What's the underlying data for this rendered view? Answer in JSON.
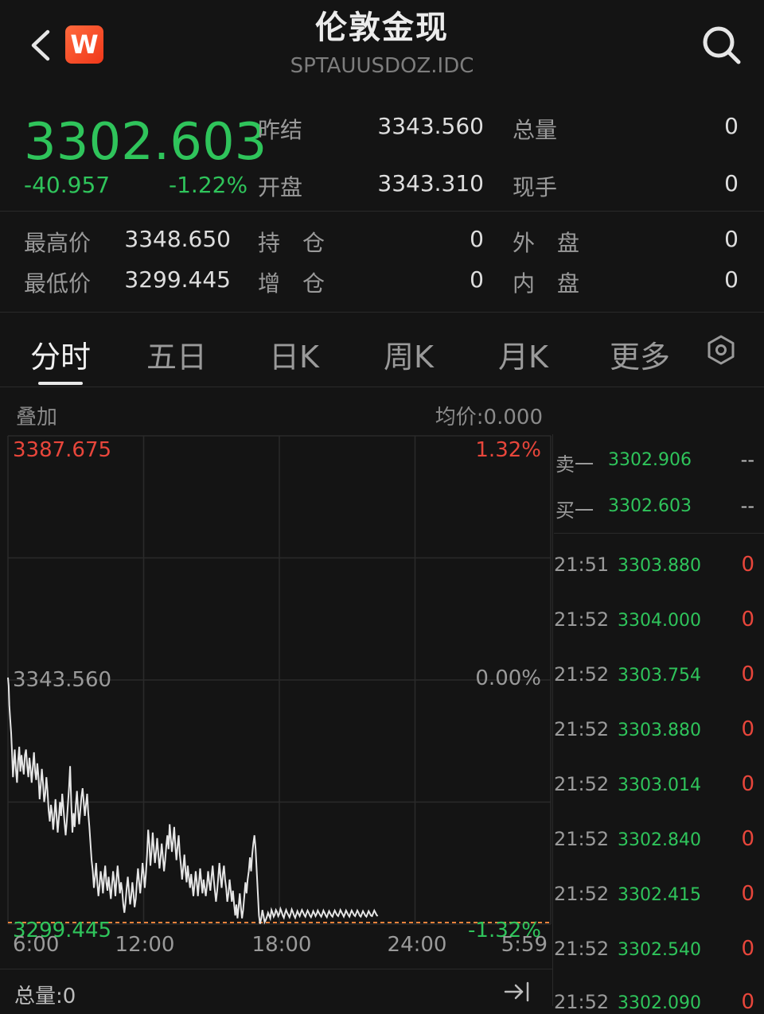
{
  "header": {
    "title": "伦敦金现",
    "code": "SPTAUUSDOZ.IDC",
    "logo_letter": "W"
  },
  "quote": {
    "price": "3302.603",
    "change": "-40.957",
    "change_pct": "-1.22%",
    "fields": [
      {
        "label": "昨结",
        "value": "3343.560"
      },
      {
        "label": "开盘",
        "value": "3343.310"
      },
      {
        "label": "总量",
        "value": "0"
      },
      {
        "label": "现手",
        "value": "0"
      },
      {
        "label": "最高价",
        "value": "3348.650"
      },
      {
        "label": "最低价",
        "value": "3299.445"
      },
      {
        "label": "持　仓",
        "value": "0"
      },
      {
        "label": "增　仓",
        "value": "0"
      },
      {
        "label": "外　盘",
        "value": "0"
      },
      {
        "label": "内　盘",
        "value": "0"
      }
    ]
  },
  "tabs": [
    "分时",
    "五日",
    "日K",
    "周K",
    "月K",
    "更多"
  ],
  "chart_header": {
    "overlay_label": "叠加",
    "avg_label": "均价:0.000"
  },
  "chart_data": {
    "type": "line",
    "x_ticks": [
      "6:00",
      "12:00",
      "18:00",
      "24:00",
      "5:59"
    ],
    "y_left_ticks": [
      "3387.675",
      "3343.560",
      "3299.445"
    ],
    "y_right_ticks": [
      "1.32%",
      "0.00%",
      "-1.32%"
    ],
    "ylim": [
      3299.445,
      3387.675
    ],
    "reference": 3343.56,
    "colors": {
      "up": "#e8463b",
      "flat": "#9a9a9a",
      "down": "#2fc45b",
      "line": "#e6e6e6",
      "ref": "#e8823b"
    },
    "x": [
      0,
      0.03,
      0.06,
      0.1,
      0.14,
      0.18,
      0.22,
      0.26,
      0.3,
      0.35,
      0.4,
      0.45,
      0.5,
      0.55,
      0.6,
      0.65,
      0.7,
      0.75,
      0.8,
      0.85,
      0.9,
      0.95,
      1.0,
      1.05,
      1.1,
      1.15,
      1.2,
      1.25,
      1.3,
      1.35,
      1.4,
      1.45,
      1.5,
      1.55,
      1.6,
      1.65,
      1.7,
      1.75,
      1.8,
      1.85,
      1.9,
      1.95,
      2.0,
      2.05,
      2.1,
      2.15,
      2.2,
      2.25,
      2.3,
      2.35,
      2.4,
      2.45,
      2.5,
      2.55,
      2.6,
      2.65,
      2.7,
      2.75,
      2.8,
      2.85,
      2.9,
      2.95,
      3.0,
      3.05,
      3.1,
      3.15,
      3.2,
      3.25,
      3.3,
      3.35,
      3.4,
      3.45,
      3.5,
      3.55,
      3.6,
      3.65,
      3.7,
      3.75,
      3.8,
      3.85,
      3.9,
      3.95,
      4.0,
      4.05,
      4.1,
      4.15,
      4.2,
      4.25,
      4.3,
      4.35,
      4.4,
      4.45,
      4.5,
      4.55,
      4.6,
      4.65,
      4.7,
      4.75,
      4.8,
      4.85,
      4.9,
      4.95,
      5.0,
      5.05,
      5.1,
      5.15,
      5.2,
      5.25,
      5.3,
      5.35,
      5.4,
      5.45,
      5.5,
      5.55,
      5.6,
      5.65,
      5.7,
      5.75,
      5.8,
      5.85,
      5.9,
      5.95,
      6.0,
      6.05,
      6.1,
      6.15,
      6.2,
      6.25,
      6.3,
      6.35,
      6.4,
      6.45,
      6.5,
      6.55,
      6.6,
      6.65,
      6.7,
      6.75,
      6.8,
      6.85,
      6.9,
      6.95,
      7.0,
      7.05,
      7.1,
      7.15,
      7.2,
      7.25,
      7.3,
      7.35,
      7.4,
      7.45,
      7.5,
      7.55,
      7.6,
      7.65,
      7.7,
      7.75,
      7.8,
      7.85,
      7.9,
      7.95,
      8.0,
      8.05,
      8.1,
      8.15,
      8.2,
      8.25,
      8.3,
      8.35,
      8.4,
      8.45,
      8.5,
      8.55,
      8.6,
      8.65,
      8.7,
      8.75,
      8.8,
      8.85,
      8.9,
      8.95,
      9.0,
      9.05,
      9.1,
      9.15,
      9.2,
      9.25,
      9.3,
      9.35,
      9.4,
      9.45,
      9.5,
      9.55,
      9.6,
      9.65,
      9.7,
      9.75,
      9.8,
      9.85,
      9.9,
      9.95,
      10.0,
      10.05,
      10.1,
      10.15,
      10.2,
      10.25,
      10.3,
      10.35,
      10.4,
      10.45,
      10.5,
      10.55,
      10.6,
      10.65,
      10.7,
      10.75,
      10.8,
      10.85,
      10.9,
      10.95,
      11.0,
      11.05,
      11.1,
      11.15,
      11.2,
      11.25,
      11.3,
      11.35,
      11.4,
      11.45,
      11.5,
      11.55,
      11.6,
      11.65,
      11.7,
      11.75,
      11.8,
      11.85,
      11.9,
      11.95,
      12.0,
      12.05,
      12.1,
      12.15,
      12.2,
      12.25,
      12.3,
      12.35,
      12.4,
      12.45,
      12.5,
      12.55,
      12.6,
      12.65,
      12.7,
      12.75,
      12.8,
      12.85,
      12.9,
      12.95,
      13.0,
      13.05,
      13.1,
      13.15,
      13.2,
      13.25,
      13.3,
      13.35,
      13.4,
      13.45,
      13.5,
      13.55,
      13.6,
      13.65,
      13.7,
      13.75,
      13.8,
      13.85,
      13.9,
      13.95,
      14.0,
      14.05,
      14.1,
      14.15,
      14.2,
      14.25,
      14.3,
      14.35,
      14.4,
      14.45,
      14.5,
      14.55,
      14.6,
      14.65,
      14.7,
      14.75,
      14.8,
      14.85,
      14.9,
      14.95,
      15.0,
      15.05,
      15.1,
      15.15,
      15.2,
      15.25,
      15.3,
      15.35,
      15.4,
      15.45,
      15.5,
      15.55,
      15.6,
      15.65,
      15.7,
      15.75,
      15.8,
      15.85,
      15.9,
      15.95,
      16.0,
      16.05,
      16.1,
      16.15,
      16.2,
      16.25,
      16.3,
      16.35,
      16.4,
      16.45,
      16.5
    ],
    "values": [
      3344.0,
      3342.5,
      3339.0,
      3336.5,
      3334.0,
      3330.5,
      3326.0,
      3328.5,
      3331.0,
      3327.5,
      3325.0,
      3329.0,
      3331.5,
      3327.0,
      3330.0,
      3328.0,
      3326.5,
      3330.0,
      3331.0,
      3328.0,
      3326.0,
      3329.5,
      3327.5,
      3325.0,
      3328.0,
      3330.5,
      3327.0,
      3325.5,
      3328.5,
      3326.0,
      3322.0,
      3324.5,
      3327.5,
      3325.0,
      3321.5,
      3323.0,
      3326.0,
      3323.5,
      3320.0,
      3318.0,
      3321.0,
      3319.5,
      3316.5,
      3319.0,
      3322.0,
      3319.0,
      3316.0,
      3318.5,
      3321.5,
      3319.0,
      3323.0,
      3320.5,
      3318.0,
      3315.5,
      3318.0,
      3321.0,
      3324.0,
      3328.0,
      3321.0,
      3316.0,
      3319.5,
      3317.0,
      3321.0,
      3323.5,
      3320.0,
      3317.5,
      3320.0,
      3322.5,
      3324.0,
      3321.5,
      3319.0,
      3321.0,
      3323.0,
      3319.5,
      3317.0,
      3314.0,
      3311.0,
      3309.0,
      3306.0,
      3308.0,
      3310.5,
      3307.0,
      3304.5,
      3306.5,
      3309.0,
      3307.5,
      3305.0,
      3308.0,
      3310.0,
      3307.0,
      3305.5,
      3308.0,
      3306.0,
      3304.0,
      3306.5,
      3309.0,
      3307.0,
      3304.5,
      3307.5,
      3310.0,
      3307.5,
      3305.0,
      3307.0,
      3305.5,
      3303.0,
      3301.5,
      3303.5,
      3306.0,
      3308.0,
      3305.5,
      3303.0,
      3304.5,
      3307.0,
      3305.0,
      3302.5,
      3304.0,
      3307.0,
      3309.5,
      3307.0,
      3305.0,
      3307.5,
      3310.5,
      3308.5,
      3306.0,
      3308.5,
      3312.0,
      3316.5,
      3314.0,
      3310.0,
      3312.5,
      3316.0,
      3313.0,
      3310.5,
      3312.5,
      3315.0,
      3312.0,
      3309.5,
      3311.5,
      3314.0,
      3311.5,
      3309.0,
      3311.0,
      3313.5,
      3315.5,
      3313.0,
      3317.5,
      3315.0,
      3312.5,
      3314.5,
      3317.0,
      3313.5,
      3311.0,
      3313.5,
      3315.5,
      3312.0,
      3310.0,
      3307.5,
      3309.5,
      3312.0,
      3309.0,
      3307.0,
      3310.0,
      3308.0,
      3306.0,
      3308.5,
      3306.5,
      3304.5,
      3306.5,
      3309.0,
      3307.0,
      3304.5,
      3307.0,
      3309.5,
      3307.0,
      3305.0,
      3307.5,
      3306.0,
      3304.5,
      3306.5,
      3309.0,
      3307.0,
      3305.5,
      3308.0,
      3310.0,
      3307.5,
      3305.5,
      3303.5,
      3305.5,
      3308.0,
      3310.5,
      3308.0,
      3306.0,
      3308.5,
      3310.0,
      3307.5,
      3306.0,
      3303.5,
      3305.0,
      3307.5,
      3305.5,
      3303.5,
      3305.5,
      3303.0,
      3301.0,
      3303.0,
      3300.5,
      3302.5,
      3305.0,
      3302.5,
      3300.5,
      3302.0,
      3304.5,
      3307.0,
      3305.0,
      3307.5,
      3309.0,
      3311.5,
      3309.0,
      3312.0,
      3314.0,
      3315.5,
      3313.0,
      3309.0,
      3305.0,
      3301.0,
      3299.5,
      3300.5,
      3302.0,
      3301.0,
      3299.8,
      3300.2,
      3300.8,
      3301.5,
      3301.0,
      3300.5,
      3302.0,
      3301.5,
      3300.8,
      3301.2,
      3302.0,
      3301.6,
      3300.9,
      3301.3,
      3302.2,
      3301.7,
      3301.0,
      3300.6,
      3301.4,
      3302.0,
      3301.5,
      3301.1,
      3300.7,
      3301.3,
      3302.1,
      3301.6,
      3301.0,
      3300.6,
      3301.2,
      3301.8,
      3301.3,
      3300.9,
      3301.5,
      3302.0,
      3301.6,
      3301.1,
      3300.8,
      3301.4,
      3301.9,
      3301.5,
      3301.0,
      3300.7,
      3301.2,
      3301.8,
      3301.4,
      3300.9,
      3301.3,
      3301.9,
      3301.5,
      3301.1,
      3300.8,
      3301.3,
      3301.9,
      3301.5,
      3301.0,
      3300.7,
      3301.3,
      3301.8,
      3301.4,
      3301.0,
      3300.8,
      3301.4,
      3301.9,
      3301.5,
      3301.1,
      3300.9,
      3301.4,
      3302.0,
      3301.6,
      3301.2,
      3300.8,
      3301.3,
      3301.9,
      3301.5,
      3301.1,
      3300.8,
      3301.4,
      3301.9,
      3301.5,
      3301.1,
      3300.9,
      3301.4,
      3301.9,
      3301.5,
      3301.0,
      3300.8,
      3301.3,
      3301.8,
      3301.4,
      3301.0,
      3300.8,
      3301.3,
      3301.8,
      3301.4,
      3301.0,
      3300.9,
      3301.4,
      3301.9,
      3301.5,
      3301.1,
      3300.9
    ]
  },
  "order_book": [
    {
      "label": "卖一",
      "price": "3302.906",
      "qty": "--"
    },
    {
      "label": "买一",
      "price": "3302.603",
      "qty": "--"
    }
  ],
  "ticks": [
    {
      "time": "21:51",
      "price": "3303.880",
      "vol": "0"
    },
    {
      "time": "21:52",
      "price": "3304.000",
      "vol": "0"
    },
    {
      "time": "21:52",
      "price": "3303.754",
      "vol": "0"
    },
    {
      "time": "21:52",
      "price": "3303.880",
      "vol": "0"
    },
    {
      "time": "21:52",
      "price": "3303.014",
      "vol": "0"
    },
    {
      "time": "21:52",
      "price": "3302.840",
      "vol": "0"
    },
    {
      "time": "21:52",
      "price": "3302.415",
      "vol": "0"
    },
    {
      "time": "21:52",
      "price": "3302.540",
      "vol": "0"
    },
    {
      "time": "21:52",
      "price": "3302.090",
      "vol": "0"
    }
  ],
  "footer": {
    "total_volume": "总量:0"
  }
}
